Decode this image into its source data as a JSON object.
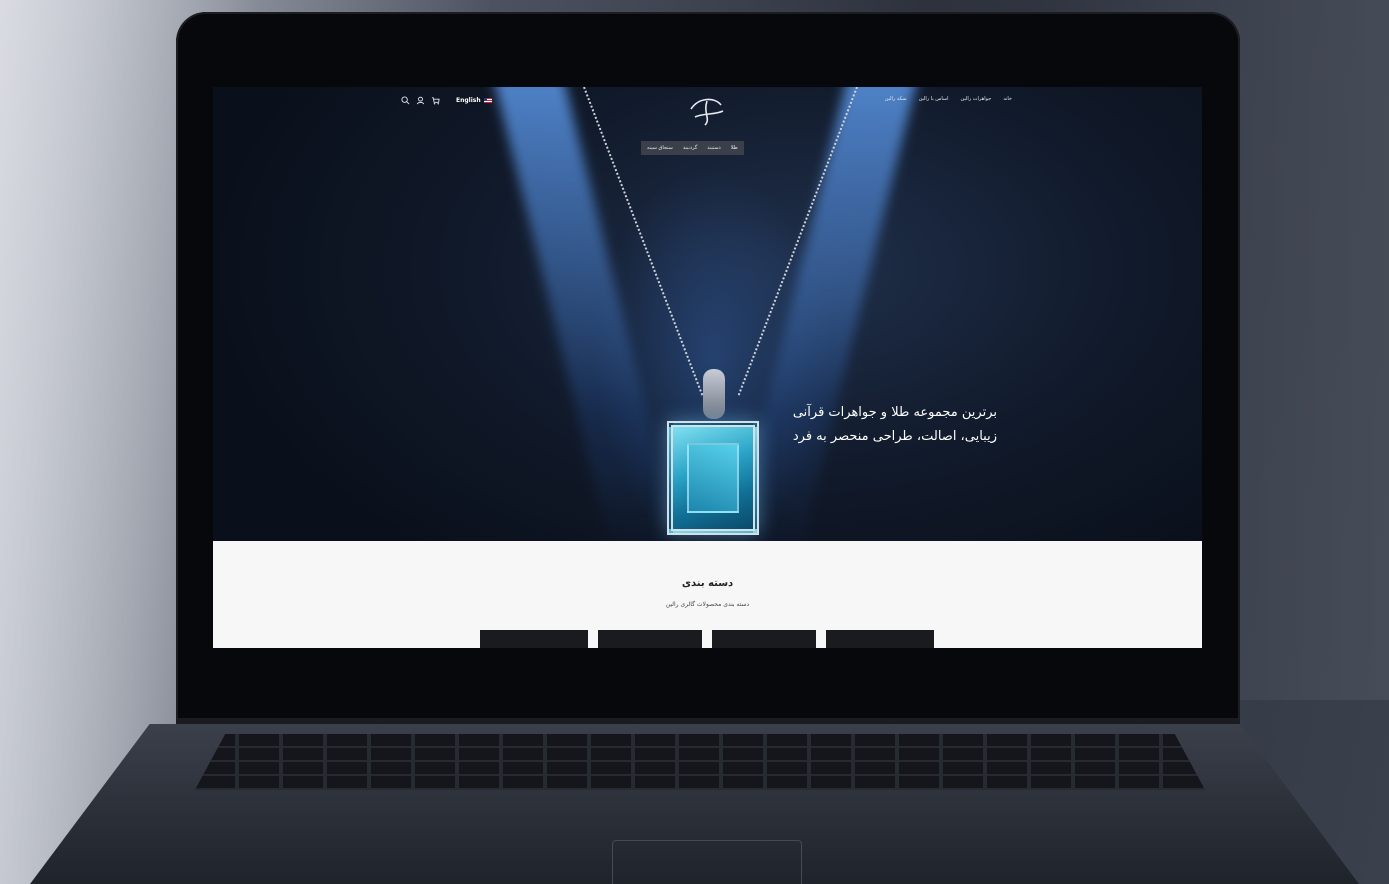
{
  "header": {
    "nav_top": [
      "خانه",
      "جواهرات رالین",
      "اساس با رالین",
      "سکه رالین"
    ],
    "language_label": "English",
    "sub_nav": [
      "طلا",
      "دستبند",
      "گردنبند",
      "سنجاق سینه"
    ]
  },
  "hero": {
    "tagline_line1": "برترین مجموعه طلا و جواهرات قرآنی",
    "tagline_line2": "زیبایی، اصالت، طراحی منحصر به فرد"
  },
  "categories": {
    "title": "دسته بندی",
    "subtitle": "دسته بندی محصولات گالری رالین"
  },
  "colors": {
    "hero_bg": "#0c1320",
    "beam": "#5a96e6",
    "section_bg": "#f7f7f8"
  },
  "icons": [
    "search-icon",
    "user-icon",
    "cart-icon",
    "flag-icon",
    "logo"
  ]
}
